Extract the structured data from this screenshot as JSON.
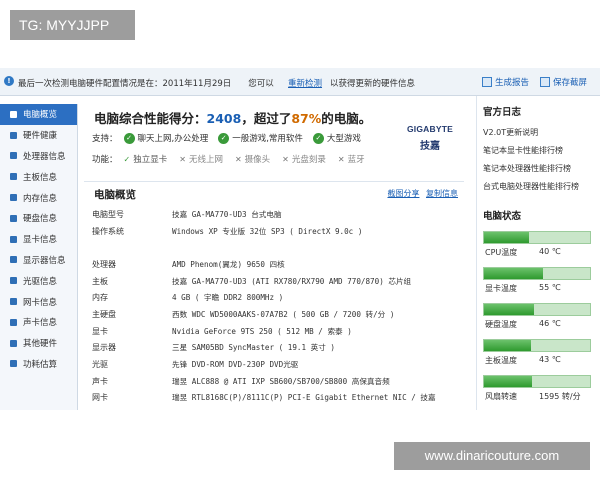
{
  "watermark_top": "TG: MYYJJPP",
  "watermark_bottom": "www.dinaricouture.com",
  "topbar": {
    "message": "最后一次检测电脑硬件配置情况是在：2011年11月29日　　您可以",
    "recheck_link": "重新检测",
    "message_suffix": "以获得更新的硬件信息",
    "report_btn": "生成报告",
    "save_btn": "保存截屏"
  },
  "sidebar": {
    "items": [
      {
        "label": "电脑概览",
        "active": true
      },
      {
        "label": "硬件健康"
      },
      {
        "label": "处理器信息"
      },
      {
        "label": "主板信息"
      },
      {
        "label": "内存信息"
      },
      {
        "label": "硬盘信息"
      },
      {
        "label": "显卡信息"
      },
      {
        "label": "显示器信息"
      },
      {
        "label": "光驱信息"
      },
      {
        "label": "网卡信息"
      },
      {
        "label": "声卡信息"
      },
      {
        "label": "其他硬件"
      },
      {
        "label": "功耗估算"
      }
    ]
  },
  "score": {
    "prefix": "电脑综合性能得分：",
    "value": "2408",
    "middle": "，超过了",
    "percent": "87%",
    "suffix": "的电脑。"
  },
  "brand": {
    "name_en": "GIGABYTE",
    "name_cn": "技嘉"
  },
  "support": {
    "label": "支持：",
    "items": [
      "聊天上网,办公处理",
      "一般游戏,常用软件",
      "大型游戏"
    ]
  },
  "functions": {
    "label": "功能：",
    "items": [
      {
        "mark": "✓",
        "text": "独立显卡",
        "ok": true
      },
      {
        "mark": "✕",
        "text": "无线上网",
        "ok": false
      },
      {
        "mark": "✕",
        "text": "摄像头",
        "ok": false
      },
      {
        "mark": "✕",
        "text": "光盘刻录",
        "ok": false
      },
      {
        "mark": "✕",
        "text": "蓝牙",
        "ok": false
      }
    ]
  },
  "overview": {
    "title": "电脑概览",
    "link_share": "截图分享",
    "link_copy": "复制信息",
    "rows": [
      {
        "key": "电脑型号",
        "value": "技嘉 GA-MA770-UD3 台式电脑"
      },
      {
        "key": "操作系统",
        "value": "Windows XP 专业版 32位 SP3 ( DirectX 9.0c )"
      },
      {
        "key": "",
        "value": ""
      },
      {
        "key": "处理器",
        "value": "AMD Phenom(翼龙) 9650 四核"
      },
      {
        "key": "主板",
        "value": "技嘉 GA-MA770-UD3 (ATI RX780/RX790 AMD 770/870) 芯片组"
      },
      {
        "key": "内存",
        "value": "4 GB ( 宇瞻 DDR2 800MHz )"
      },
      {
        "key": "主硬盘",
        "value": "西数 WDC WD5000AAKS-07A7B2 ( 500 GB / 7200 转/分 )"
      },
      {
        "key": "显卡",
        "value": "Nvidia GeForce 9TS 250 ( 512 MB / 索泰 )"
      },
      {
        "key": "显示器",
        "value": "三星 SAM05BD SyncMaster ( 19.1 英寸 )"
      },
      {
        "key": "光驱",
        "value": "先锋 DVD-ROM DVD-230P DVD光驱"
      },
      {
        "key": "声卡",
        "value": "瑞昱 ALC888 @ ATI IXP SB600/SB700/SB800 高保真音频"
      },
      {
        "key": "网卡",
        "value": "瑞昱 RTL8168C(P)/8111C(P) PCI-E Gigabit Ethernet NIC / 技嘉"
      }
    ]
  },
  "news": {
    "title": "官方日志",
    "items": [
      "V2.0T更新说明",
      "笔记本显卡性能排行榜",
      "笔记本处理器性能排行榜",
      "台式电脑处理器性能排行榜"
    ]
  },
  "status": {
    "title": "电脑状态",
    "items": [
      {
        "label": "CPU温度",
        "value": "40 ℃",
        "level": 0.42
      },
      {
        "label": "显卡温度",
        "value": "55 ℃",
        "level": 0.56
      },
      {
        "label": "硬盘温度",
        "value": "46 ℃",
        "level": 0.47
      },
      {
        "label": "主板温度",
        "value": "43 ℃",
        "level": 0.44
      },
      {
        "label": "风扇转速",
        "value": "1595 转/分",
        "level": 0.45
      }
    ]
  },
  "colors": {
    "accent": "#2c6fc2",
    "score_value": "#1a5fb4",
    "score_percent": "#d06a00",
    "ok": "#3a9a3a"
  }
}
